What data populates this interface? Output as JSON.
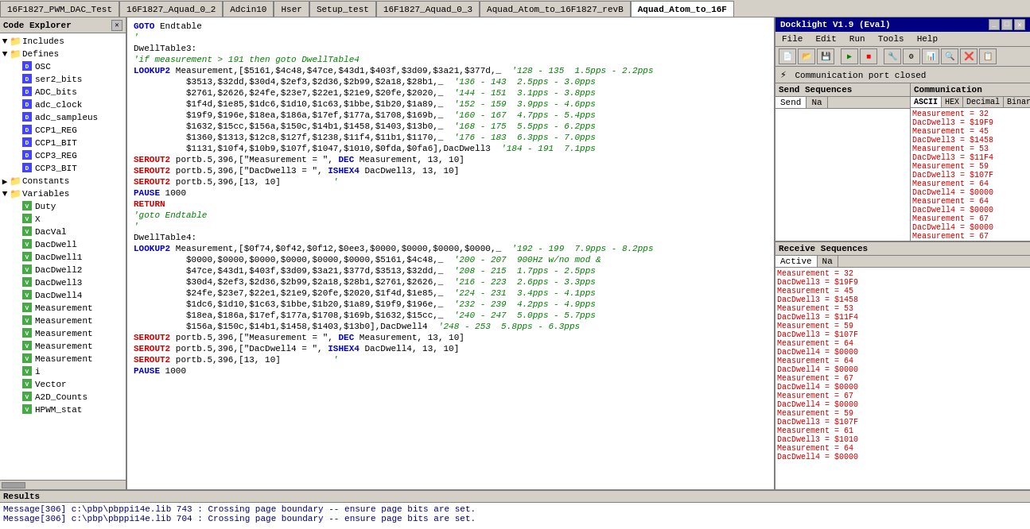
{
  "tabs": [
    {
      "label": "16F1827_PWM_DAC_Test",
      "active": false
    },
    {
      "label": "16F1827_Aquad_0_2",
      "active": false
    },
    {
      "label": "Adcin10",
      "active": false
    },
    {
      "label": "Hser",
      "active": false
    },
    {
      "label": "Setup_test",
      "active": false
    },
    {
      "label": "16F1827_Aquad_0_3",
      "active": false
    },
    {
      "label": "Aquad_Atom_to_16F1827_revB",
      "active": false
    },
    {
      "label": "Aquad_Atom_to_16F",
      "active": true
    }
  ],
  "explorer": {
    "title": "Code Explorer",
    "tree": [
      {
        "label": "Includes",
        "type": "folder",
        "depth": 0,
        "expanded": true
      },
      {
        "label": "Defines",
        "type": "folder",
        "depth": 0,
        "expanded": true
      },
      {
        "label": "OSC",
        "type": "file-d",
        "depth": 1
      },
      {
        "label": "ser2_bits",
        "type": "file-d",
        "depth": 1
      },
      {
        "label": "ADC_bits",
        "type": "file-d",
        "depth": 1
      },
      {
        "label": "adc_clock",
        "type": "file-d",
        "depth": 1
      },
      {
        "label": "adc_sampleus",
        "type": "file-d",
        "depth": 1
      },
      {
        "label": "CCP1_REG",
        "type": "file-d",
        "depth": 1
      },
      {
        "label": "CCP1_BIT",
        "type": "file-d",
        "depth": 1
      },
      {
        "label": "CCP3_REG",
        "type": "file-d",
        "depth": 1
      },
      {
        "label": "CCP3_BIT",
        "type": "file-d",
        "depth": 1
      },
      {
        "label": "Constants",
        "type": "folder",
        "depth": 0,
        "expanded": false
      },
      {
        "label": "Variables",
        "type": "folder",
        "depth": 0,
        "expanded": true
      },
      {
        "label": "Duty",
        "type": "file-v",
        "depth": 1
      },
      {
        "label": "X",
        "type": "file-v",
        "depth": 1
      },
      {
        "label": "DacVal",
        "type": "file-v",
        "depth": 1
      },
      {
        "label": "DacDwell",
        "type": "file-v",
        "depth": 1
      },
      {
        "label": "DacDwell1",
        "type": "file-v",
        "depth": 1
      },
      {
        "label": "DacDwell2",
        "type": "file-v",
        "depth": 1
      },
      {
        "label": "DacDwell3",
        "type": "file-v",
        "depth": 1
      },
      {
        "label": "DacDwell4",
        "type": "file-v",
        "depth": 1
      },
      {
        "label": "Measurement",
        "type": "file-v",
        "depth": 1
      },
      {
        "label": "Measurement",
        "type": "file-v",
        "depth": 1
      },
      {
        "label": "Measurement",
        "type": "file-v",
        "depth": 1
      },
      {
        "label": "Measurement",
        "type": "file-v",
        "depth": 1
      },
      {
        "label": "Measurement",
        "type": "file-v",
        "depth": 1
      },
      {
        "label": "i",
        "type": "file-v",
        "depth": 1
      },
      {
        "label": "Vector",
        "type": "file-v",
        "depth": 1
      },
      {
        "label": "A2D_Counts",
        "type": "file-v",
        "depth": 1
      },
      {
        "label": "HPWM_stat",
        "type": "file-v",
        "depth": 1
      }
    ]
  },
  "code": {
    "lines": [
      {
        "text": "GOTO Endtable",
        "type": "goto"
      },
      {
        "text": "'",
        "type": "comment"
      },
      {
        "text": "DwellTable3:",
        "type": "label"
      },
      {
        "text": "'if measurement > 191 then goto DwellTable4",
        "type": "comment"
      },
      {
        "text": "LOOKUP2 Measurement,[$5161,$4c48,$47ce,$43d1,$403f,$3d09,$3a21,$377d,_  '128 - 135  1.5pps - 2.2pps",
        "type": "lookup"
      },
      {
        "text": "          $3513,$32dd,$30d4,$2ef3,$2d36,$2b99,$2a18,$28b1,_  '136 - 143  2.5pps - 3.0pps",
        "type": "data"
      },
      {
        "text": "          $2761,$2626,$24fe,$23e7,$22e1,$21e9,$20fe,$2020,_  '144 - 151  3.1pps - 3.8pps",
        "type": "data"
      },
      {
        "text": "          $1f4d,$1e85,$1dc6,$1d10,$1c63,$1bbe,$1b20,$1a89,_  '152 - 159  3.9pps - 4.6pps",
        "type": "data"
      },
      {
        "text": "          $19f9,$196e,$18ea,$186a,$17ef,$177a,$1708,$169b,_  '160 - 167  4.7pps - 5.4pps",
        "type": "data"
      },
      {
        "text": "          $1632,$15cc,$156a,$150c,$14b1,$1458,$1403,$13b0,_  '168 - 175  5.5pps - 6.2pps",
        "type": "data"
      },
      {
        "text": "          $1360,$1313,$12c8,$127f,$1238,$11f4,$11b1,$1170,_  '176 - 183  6.3pps - 7.0pps",
        "type": "data"
      },
      {
        "text": "          $1131,$10f4,$10b9,$107f,$1047,$1010,$0fda,$0fa6],DacDwell3  '184 - 191  7.1pps",
        "type": "data"
      },
      {
        "text": "SEROUT2 portb.5,396,[\"Measurement = \", DEC Measurement, 13, 10]",
        "type": "serout"
      },
      {
        "text": "SEROUT2 portb.5,396,[\"DacDwell3 = \", ISHEX4 DacDwell3, 13, 10]",
        "type": "serout"
      },
      {
        "text": "SEROUT2 portb.5,396,[13, 10]          '",
        "type": "serout"
      },
      {
        "text": "PAUSE 1000",
        "type": "pause"
      },
      {
        "text": "RETURN",
        "type": "return"
      },
      {
        "text": "'goto Endtable",
        "type": "comment"
      },
      {
        "text": "'",
        "type": "comment"
      },
      {
        "text": "DwellTable4:",
        "type": "label"
      },
      {
        "text": "LOOKUP2 Measurement,[$0f74,$0f42,$0f12,$0ee3,$0000,$0000,$0000,$0000,_  '192 - 199  7.9pps - 8.2pps",
        "type": "lookup"
      },
      {
        "text": "          $0000,$0000,$0000,$0000,$0000,$0000,$5161,$4c48,_  '200 - 207  900Hz w/no mod &",
        "type": "data"
      },
      {
        "text": "          $47ce,$43d1,$403f,$3d09,$3a21,$377d,$3513,$32dd,_  '208 - 215  1.7pps - 2.5pps",
        "type": "data"
      },
      {
        "text": "          $30d4,$2ef3,$2d36,$2b99,$2a18,$28b1,$2761,$2626,_  '216 - 223  2.6pps - 3.3pps",
        "type": "data"
      },
      {
        "text": "          $24fe,$23e7,$22e1,$21e9,$20fe,$2020,$1f4d,$1e85,_  '224 - 231  3.4pps - 4.1pps",
        "type": "data"
      },
      {
        "text": "          $1dc6,$1d10,$1c63,$1bbe,$1b20,$1a89,$19f9,$196e,_  '232 - 239  4.2pps - 4.9pps",
        "type": "data"
      },
      {
        "text": "          $18ea,$186a,$17ef,$177a,$1708,$169b,$1632,$15cc,_  '240 - 247  5.0pps - 5.7pps",
        "type": "data"
      },
      {
        "text": "          $156a,$150c,$14b1,$1458,$1403,$13b0],DacDwell4  '248 - 253  5.8pps - 6.3pps",
        "type": "data"
      },
      {
        "text": "SEROUT2 portb.5,396,[\"Measurement = \", DEC Measurement, 13, 10]",
        "type": "serout"
      },
      {
        "text": "SEROUT2 portb.5,396,[\"DacDwell4 = \", ISHEX4 DacDwell4, 13, 10]",
        "type": "serout"
      },
      {
        "text": "SEROUT2 portb.5,396,[13, 10]          '",
        "type": "serout"
      },
      {
        "text": "PAUSE 1000",
        "type": "pause"
      }
    ]
  },
  "docklight": {
    "title": "Docklight V1.9 (Eval)",
    "menu": [
      "File",
      "Edit",
      "Run",
      "Tools",
      "Help"
    ],
    "status": "Communication port closed",
    "send_sequences_label": "Send Sequences",
    "communication_label": "Communication",
    "receive_sequences_label": "Receive Sequences",
    "seq_tabs": [
      "Send",
      "Na"
    ],
    "comm_tabs": [
      "ASCII",
      "HEX",
      "Decimal",
      "Binary"
    ],
    "recv_tabs": [
      "Active",
      "Na"
    ],
    "comm_data": [
      "<CR><LF>",
      "Measurement = 32<CR><LF>",
      "DacDwell3 = $19F9<CR><LF>",
      "<CR><LF>",
      "Measurement = 45<CR><LF>",
      "DacDwell3 = $1458<CR><LF>",
      "<CR><LF>",
      "Measurement = 53<CR><LF>",
      "DacDwell3 = $11F4<CR><LF>",
      "<CR><LF>",
      "Measurement = 59<CR><LF>",
      "DacDwell3 = $107F<CR><LF>",
      "<CR><LF>",
      "Measurement = 64<CR><LF>",
      "DacDwell4 = $0000<CR><LF>",
      "<CR><LF>",
      "Measurement = 64<CR><LF>",
      "DacDwell4 = $0000<CR><LF>",
      "<CR><LF>",
      "Measurement = 67<CR><LF>",
      "DacDwell4 = $0000<CR><LF>",
      "<CR><LF>",
      "Measurement = 67<CR><LF>",
      "DacDwell4 = $0000<CR><LF>",
      "<CR><LF>",
      "Measurement = 59<CR><LF>",
      "DacDwell3 = $107F<CR><LF>",
      "<CR><LF>",
      "Measurement = 61<CR><LF>",
      "DacDwell3 = $1010<CR><LF>",
      "<CR><LF>",
      "Measurement = 64<CR><LF>",
      "DacDwell4 = $0000<CR><LF>",
      "<CR><LF>"
    ]
  },
  "results": {
    "title": "Results",
    "lines": [
      "Message[306] c:\\pbp\\pbppi14e.lib 743 : Crossing page boundary -- ensure page bits are set.",
      "Message[306] c:\\pbp\\pbppi14e.lib 704 : Crossing page boundary -- ensure page bits are set."
    ]
  }
}
